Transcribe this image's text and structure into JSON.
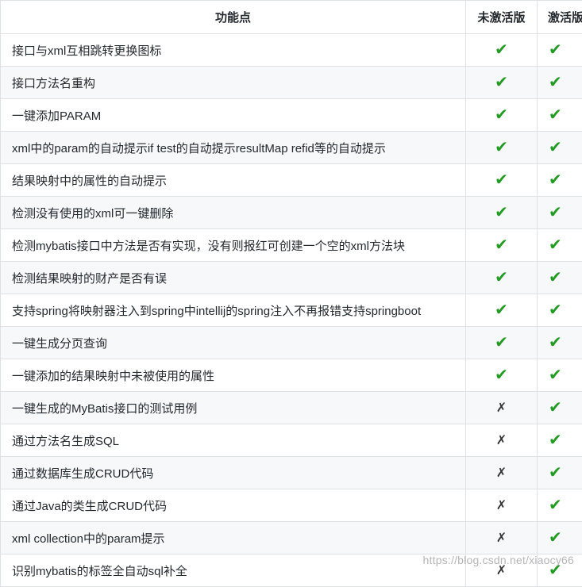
{
  "table": {
    "headers": [
      "功能点",
      "未激活版",
      "激活版"
    ],
    "yes_glyph": "✔",
    "no_glyph": "✗",
    "rows": [
      {
        "feature": "接口与xml互相跳转更换图标",
        "free": "yes",
        "paid": "yes"
      },
      {
        "feature": "接口方法名重构",
        "free": "yes",
        "paid": "yes"
      },
      {
        "feature": "一键添加PARAM",
        "free": "yes",
        "paid": "yes"
      },
      {
        "feature": "xml中的param的自动提示if test的自动提示resultMap refid等的自动提示",
        "free": "yes",
        "paid": "yes"
      },
      {
        "feature": "结果映射中的属性的自动提示",
        "free": "yes",
        "paid": "yes"
      },
      {
        "feature": "检测没有使用的xml可一键删除",
        "free": "yes",
        "paid": "yes"
      },
      {
        "feature": "检测mybatis接口中方法是否有实现，没有则报红可创建一个空的xml方法块",
        "free": "yes",
        "paid": "yes"
      },
      {
        "feature": "检测结果映射的财产是否有误",
        "free": "yes",
        "paid": "yes"
      },
      {
        "feature": "支持spring将映射器注入到spring中intellij的spring注入不再报错支持springboot",
        "free": "yes",
        "paid": "yes"
      },
      {
        "feature": "一键生成分页查询",
        "free": "yes",
        "paid": "yes"
      },
      {
        "feature": "一键添加的结果映射中未被使用的属性",
        "free": "yes",
        "paid": "yes"
      },
      {
        "feature": "一键生成的MyBatis接口的测试用例",
        "free": "no",
        "paid": "yes"
      },
      {
        "feature": "通过方法名生成SQL",
        "free": "no",
        "paid": "yes"
      },
      {
        "feature": "通过数据库生成CRUD代码",
        "free": "no",
        "paid": "yes"
      },
      {
        "feature": "通过Java的类生成CRUD代码",
        "free": "no",
        "paid": "yes"
      },
      {
        "feature": "xml collection中的param提示",
        "free": "no",
        "paid": "yes"
      },
      {
        "feature": "识别mybatis的标签全自动sql补全",
        "free": "no",
        "paid": "yes"
      }
    ]
  },
  "watermark": "https://blog.csdn.net/xiaocy66",
  "colors": {
    "check": "#239b23",
    "cross": "#333333",
    "border": "#dfe2e5",
    "stripe": "#f6f8fa"
  }
}
